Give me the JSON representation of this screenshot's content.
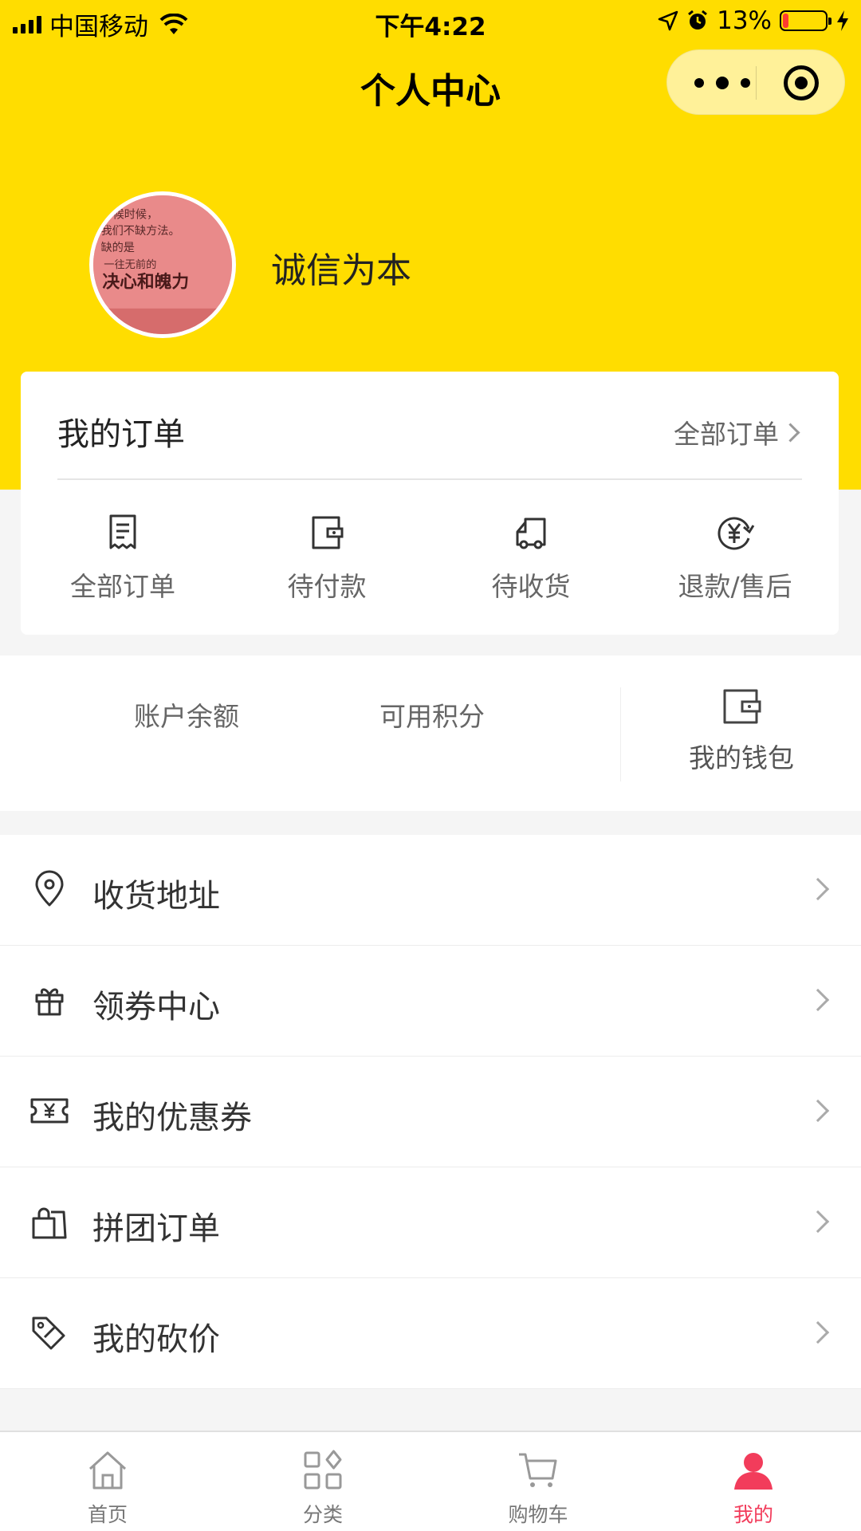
{
  "status_bar": {
    "carrier": "中国移动",
    "time": "下午4:22",
    "battery": "13%",
    "battery_level": 0.13
  },
  "nav": {
    "title": "个人中心"
  },
  "profile": {
    "avatar_text": [
      "候时候，",
      "我们不缺方法。",
      "缺的是",
      "一往无前的",
      "决心和魄力"
    ],
    "username": "诚信为本"
  },
  "orders": {
    "title": "我的订单",
    "all_link": "全部订单",
    "items": [
      {
        "label": "全部订单",
        "icon": "order-list-icon"
      },
      {
        "label": "待付款",
        "icon": "wallet-icon"
      },
      {
        "label": "待收货",
        "icon": "truck-icon"
      },
      {
        "label": "退款/售后",
        "icon": "refund-icon"
      }
    ]
  },
  "wallet": {
    "balance_label": "账户余额",
    "points_label": "可用积分",
    "wallet_label": "我的钱包"
  },
  "menu": [
    {
      "label": "收货地址",
      "icon": "location-pin-icon"
    },
    {
      "label": "领券中心",
      "icon": "gift-icon"
    },
    {
      "label": "我的优惠券",
      "icon": "coupon-icon"
    },
    {
      "label": "拼团订单",
      "icon": "shopping-bag-icon"
    },
    {
      "label": "我的砍价",
      "icon": "price-tag-icon"
    }
  ],
  "tabbar": {
    "items": [
      {
        "label": "首页",
        "icon": "home-icon",
        "active": false
      },
      {
        "label": "分类",
        "icon": "category-icon",
        "active": false
      },
      {
        "label": "购物车",
        "icon": "cart-icon",
        "active": false
      },
      {
        "label": "我的",
        "icon": "user-icon",
        "active": true
      }
    ]
  },
  "colors": {
    "brand_yellow": "#ffdd00",
    "active_tab": "#f23c5b",
    "background": "#f5f5f5"
  }
}
